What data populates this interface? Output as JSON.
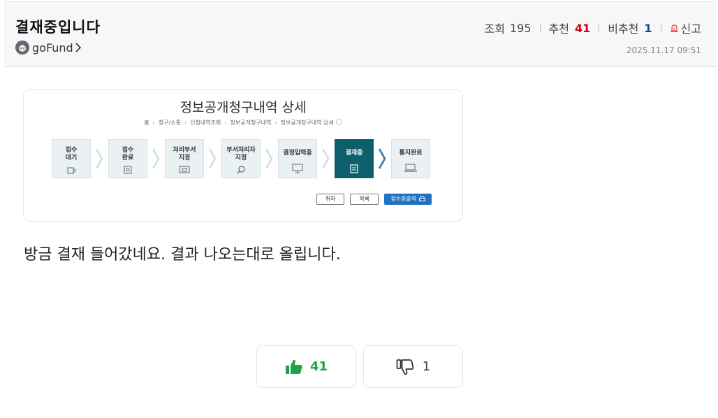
{
  "post": {
    "title": "결재중입니다",
    "author": "goFund",
    "views_label": "조회",
    "views": "195",
    "upvote_label": "추천",
    "upvotes": "41",
    "downvote_label": "비추천",
    "downvotes": "1",
    "report_label": "신고",
    "datetime": "2025.11.17 09:51",
    "body": "방금 결재 들어갔네요. 결과 나오는대로 올립니다."
  },
  "screenshot": {
    "title": "정보공개청구내역 상세",
    "breadcrumb": [
      "홈",
      "청구/소통",
      "신청내역조회",
      "정보공개청구내역",
      "정보공개청구내역 상세"
    ],
    "steps": [
      {
        "line1": "접수",
        "line2": "대기",
        "icon": "cup-icon"
      },
      {
        "line1": "접수",
        "line2": "완료",
        "icon": "document-icon"
      },
      {
        "line1": "처리부서",
        "line2": "지정",
        "icon": "building-icon"
      },
      {
        "line1": "부서처리자",
        "line2": "지정",
        "icon": "magnifier-icon"
      },
      {
        "line1": "결정입력중",
        "line2": "",
        "icon": "monitor-icon"
      },
      {
        "line1": "결재중",
        "line2": "",
        "icon": "clipboard-icon",
        "active": true
      },
      {
        "line1": "통지완료",
        "line2": "",
        "icon": "laptop-icon"
      }
    ],
    "buttons": {
      "cancel": "취하",
      "list": "목록",
      "print": "접수증출력"
    }
  },
  "votes": {
    "up": "41",
    "down": "1"
  },
  "colors": {
    "upvote": "#d0021b",
    "downvote": "#1a3fa0",
    "like_green": "#1fa34a",
    "active_step": "#0d5f6e",
    "print_button": "#1f72c2"
  }
}
